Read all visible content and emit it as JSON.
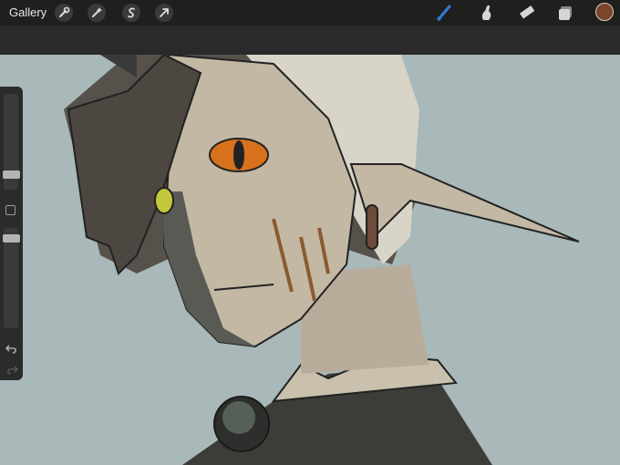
{
  "toolbar": {
    "gallery_label": "Gallery",
    "left_tools": [
      "wrench-icon",
      "magic-wand-icon",
      "selection-icon",
      "transform-arrow-icon"
    ],
    "right_tools": [
      "brush-icon",
      "smudge-icon",
      "eraser-icon",
      "layers-icon"
    ],
    "active_tool": "brush-icon",
    "accent_color": "#2f7ad6",
    "current_color": "#7a4528"
  },
  "sidebar": {
    "brush_size_level": 0.6,
    "opacity_level": 0.15,
    "icons": [
      "modify-square-icon",
      "undo-icon",
      "redo-icon"
    ]
  },
  "canvas": {
    "background_color": "#a9b8b9"
  }
}
